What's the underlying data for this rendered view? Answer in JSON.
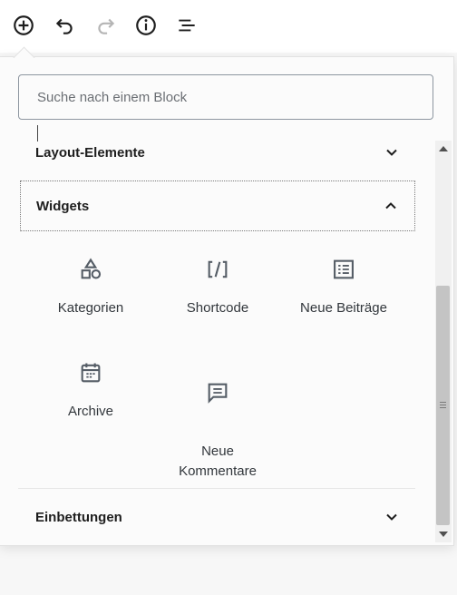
{
  "toolbar": {
    "items": [
      {
        "name": "add-block-icon"
      },
      {
        "name": "undo-icon"
      },
      {
        "name": "redo-icon"
      },
      {
        "name": "info-icon"
      },
      {
        "name": "list-view-icon"
      }
    ]
  },
  "search": {
    "placeholder": "Suche nach einem Block",
    "value": ""
  },
  "sections": {
    "layout": {
      "label": "Layout-Elemente",
      "expanded": false
    },
    "widgets": {
      "label": "Widgets",
      "expanded": true,
      "blocks": [
        {
          "label": "Kategorien",
          "icon": "categories-icon"
        },
        {
          "label": "Shortcode",
          "icon": "shortcode-icon"
        },
        {
          "label": "Neue Beiträge",
          "icon": "latest-posts-icon"
        },
        {
          "label": "Archive",
          "icon": "calendar-icon"
        },
        {
          "label": "Neue\nKommentare",
          "icon": "comments-icon"
        }
      ]
    },
    "embeds": {
      "label": "Einbettungen",
      "expanded": false
    }
  },
  "colors": {
    "text": "#1e1e1e",
    "muted_icon": "#b5b5b5",
    "icon": "#555d66"
  }
}
